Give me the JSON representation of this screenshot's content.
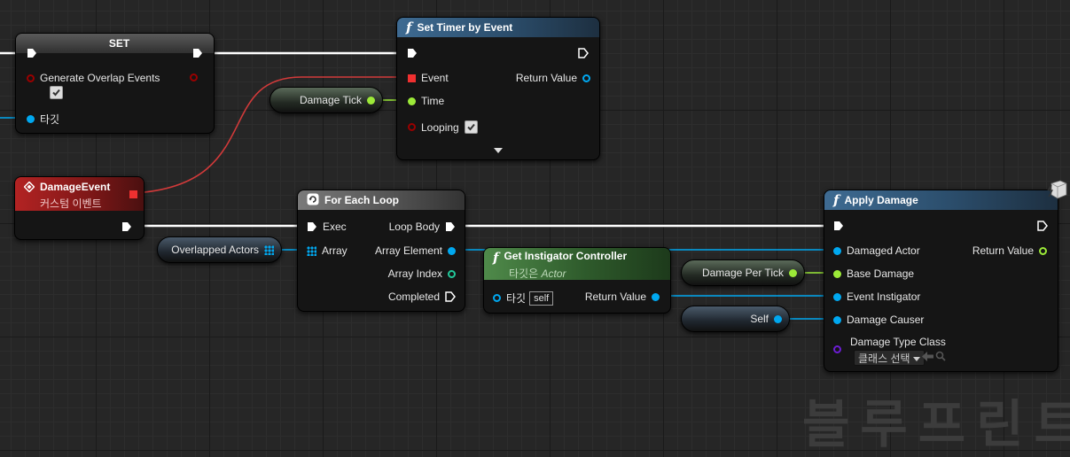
{
  "nodes": {
    "set": {
      "title": "SET",
      "generate_overlap_events": "Generate Overlap Events",
      "target_pin": "타깃"
    },
    "set_timer": {
      "title": "Set Timer by Event",
      "event_pin": "Event",
      "return_value": "Return Value",
      "time_pin": "Time",
      "looping_pin": "Looping",
      "looping_checked": true
    },
    "damage_event": {
      "title": "DamageEvent",
      "subtitle": "커스텀 이벤트"
    },
    "for_each": {
      "title": "For Each Loop",
      "exec_pin": "Exec",
      "loop_body": "Loop Body",
      "array_pin": "Array",
      "array_element": "Array Element",
      "array_index": "Array Index",
      "completed": "Completed"
    },
    "get_instigator": {
      "title": "Get Instigator Controller",
      "subtitle_prefix": "타깃은",
      "subtitle_class": "Actor",
      "target_pin": "타깃",
      "self_tag": "self",
      "return_value": "Return Value"
    },
    "apply_damage": {
      "title": "Apply Damage",
      "damaged_actor": "Damaged Actor",
      "return_value": "Return Value",
      "base_damage": "Base Damage",
      "event_instigator": "Event Instigator",
      "damage_causer": "Damage Causer",
      "damage_type_class": "Damage Type Class",
      "class_select": "클래스 선택"
    }
  },
  "variables": {
    "damage_tick": "Damage Tick",
    "overlapped_actors": "Overlapped Actors",
    "damage_per_tick": "Damage Per Tick",
    "self": "Self"
  },
  "watermark": "블루프린트",
  "colors": {
    "exec_wire": "#ffffff",
    "object_wire": "#00a8f0",
    "float_wire": "#9cea38",
    "delegate_wire": "#d23a3a",
    "event_header": "#b32323",
    "function_header": "#3e6b92",
    "pure_header": "#4f8a4a"
  },
  "icons": [
    "function-icon",
    "loop-icon",
    "event-diamond-icon",
    "exec-pin-icon",
    "array-grid-icon",
    "checkbox-icon",
    "dropdown-arrow-icon",
    "back-arrow-icon",
    "search-icon",
    "clock-server-icon"
  ]
}
